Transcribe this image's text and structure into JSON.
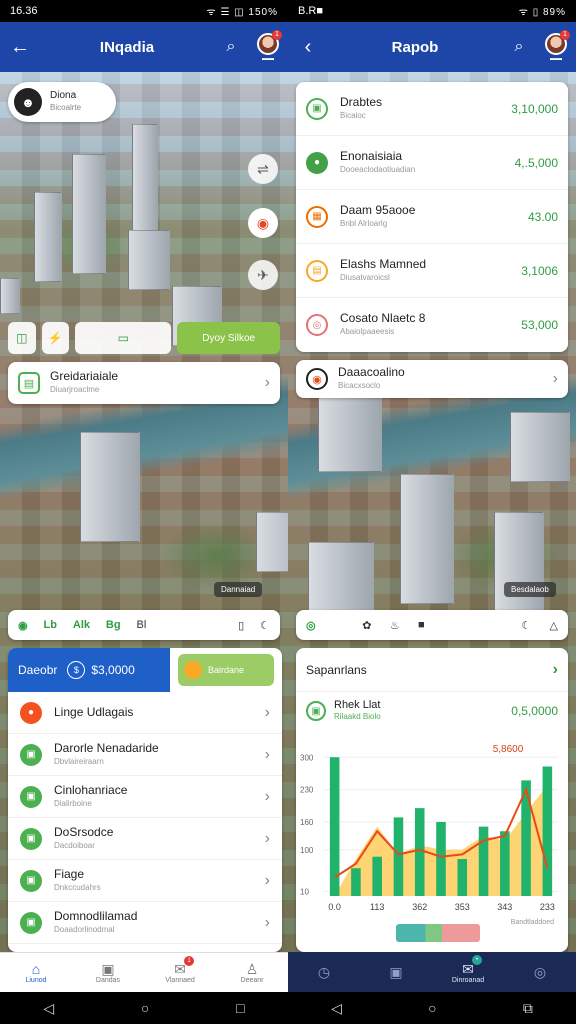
{
  "left": {
    "status": {
      "time": "16.36",
      "icons": "ᯤ ☰ ◫ 150%"
    },
    "appbar": {
      "title": "INqadia"
    },
    "profile": {
      "name": "Diona",
      "sub": "Bicoalrte"
    },
    "chips": [
      {
        "icon": "◫"
      },
      {
        "icon": "⚡"
      },
      {
        "icon": "▭"
      },
      {
        "label": "Dyoy Silkoe"
      }
    ],
    "summary_row": {
      "title": "Greidariaiale",
      "sub": "Diuarjroaclme"
    },
    "map_caption": "Dannaiad",
    "toolbar": {
      "items": [
        "Lb",
        "Alk",
        "Bg",
        "Bl"
      ],
      "right_items": [
        "▯",
        "☾"
      ]
    },
    "search": {
      "label": "Daeobr",
      "amount": "$3,0000",
      "badge": "Bairdane"
    },
    "items": [
      {
        "title": "Linge Udlagais",
        "sub": ""
      },
      {
        "title": "Darorle Nenadaride",
        "sub": "Dbvlaireiraarn"
      },
      {
        "title": "Cinlohanriace",
        "sub": "Dialirboine"
      },
      {
        "title": "DoSrsodce",
        "sub": "Dacdoiboar"
      },
      {
        "title": "Fiage",
        "sub": "Dnkccudahrs"
      },
      {
        "title": "Domnodlilamad",
        "sub": "Doaadorlinodmal"
      }
    ],
    "nav": [
      "Liunod",
      "Dandas",
      "Vlannaed",
      "Deeanr"
    ]
  },
  "right": {
    "status": {
      "time": "B.R■",
      "icons": "ᯤ ▯ 89%"
    },
    "appbar": {
      "title": "Rapob"
    },
    "list": [
      {
        "title": "Drabtes",
        "sub": "Bicaioc",
        "value": "3,10,000",
        "color": "#4caf50"
      },
      {
        "title": "Enonaisiaia",
        "sub": "Dooeaclodaotiuadian",
        "value": "4,.5,000",
        "color": "#43a047"
      },
      {
        "title": "Daam 95aooe",
        "sub": "Bnbl Alrloarlg",
        "value": "43.00",
        "color": "#ef6c00"
      },
      {
        "title": "Elashs Mamned",
        "sub": "Diusatvaroicsl",
        "value": "3,1006",
        "color": "#f9a825"
      },
      {
        "title": "Cosato Nlaetc 8",
        "sub": "Abaiolpaaeesis",
        "value": "53,000",
        "color": "#e57373"
      }
    ],
    "info_row": {
      "title": "Daaacoalino",
      "sub": "Bicacxsoclo"
    },
    "map_caption": "Besdalaob",
    "toolbar": {
      "items": [
        "◎",
        "✿",
        "♨",
        "■"
      ],
      "right_items": [
        "☾",
        "△"
      ]
    },
    "chart_card": {
      "title": "Sapanrlans",
      "sub_title": "Rhek Llat",
      "sub_caption": "Rilaakd Biolo",
      "sub_value": "0,5,0000",
      "peak_label": "5,8600",
      "footer": "Bandtladdoed"
    },
    "nav": [
      "",
      "",
      "Dinroanad",
      ""
    ]
  },
  "chart_data": {
    "type": "bar",
    "categories": [
      "0.0",
      "",
      "113",
      "",
      "362",
      "",
      "353",
      "",
      "343",
      "",
      "233"
    ],
    "series": [
      {
        "values": [
          300,
          60,
          85,
          170,
          190,
          160,
          80,
          150,
          140,
          250,
          280
        ]
      },
      {
        "values": [
          0,
          80,
          150,
          90,
          110,
          100,
          100,
          130,
          120,
          180,
          240
        ]
      }
    ],
    "line": [
      40,
      70,
      140,
      90,
      100,
      85,
      90,
      120,
      130,
      230,
      60
    ],
    "y_ticks": [
      "300",
      "230",
      "160",
      "100",
      "10"
    ],
    "ylim": [
      0,
      320
    ],
    "colors": {
      "bar": "#21b36b",
      "area": "#ffcc5c",
      "line": "#e64a19"
    }
  }
}
